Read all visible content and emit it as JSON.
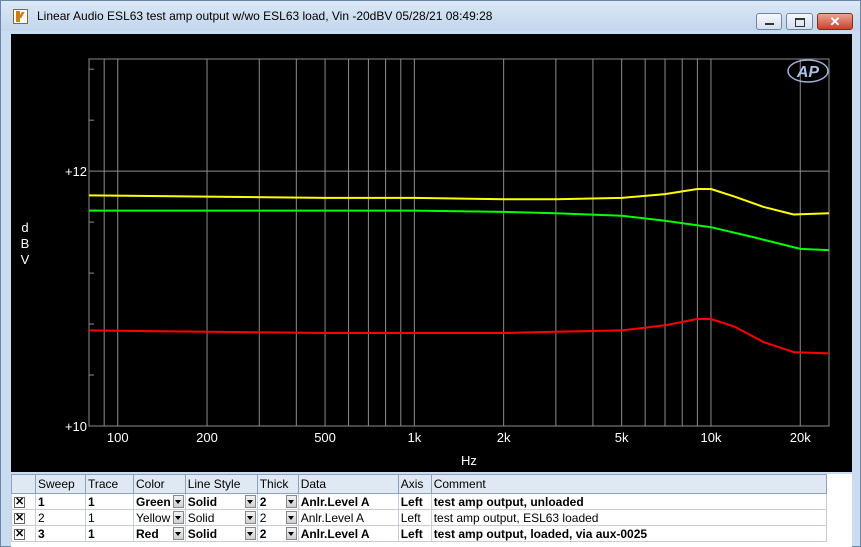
{
  "window": {
    "title": "Linear Audio  ESL63 test amp output w/wo ESL63 load, Vin -20dBV  05/28/21 08:49:28"
  },
  "logo": "AP",
  "chart_data": {
    "type": "line",
    "ylabel": [
      "d",
      "B",
      "V"
    ],
    "xlabel": "Hz",
    "xscale": "log",
    "xlim": [
      80,
      25000
    ],
    "ylim": [
      10,
      12.88
    ],
    "x_ticks": [
      {
        "v": 100,
        "label": "100"
      },
      {
        "v": 200,
        "label": "200"
      },
      {
        "v": 500,
        "label": "500"
      },
      {
        "v": 1000,
        "label": "1k"
      },
      {
        "v": 2000,
        "label": "2k"
      },
      {
        "v": 5000,
        "label": "5k"
      },
      {
        "v": 10000,
        "label": "10k"
      },
      {
        "v": 20000,
        "label": "20k"
      }
    ],
    "y_ticks": [
      {
        "v": 10,
        "label": "+10"
      },
      {
        "v": 12,
        "label": "+12"
      }
    ],
    "series": [
      {
        "name": "test amp output, unloaded",
        "color": "#00ff00",
        "x": [
          80,
          200,
          500,
          1000,
          2000,
          3000,
          5000,
          7000,
          10000,
          14000,
          20000,
          25000
        ],
        "y": [
          11.69,
          11.69,
          11.69,
          11.69,
          11.68,
          11.67,
          11.65,
          11.61,
          11.56,
          11.48,
          11.39,
          11.38
        ]
      },
      {
        "name": "test amp output, ESL63 loaded",
        "color": "#ffff00",
        "x": [
          80,
          200,
          500,
          1000,
          2000,
          3000,
          5000,
          7000,
          9000,
          10000,
          12000,
          15000,
          19000,
          25000
        ],
        "y": [
          11.81,
          11.8,
          11.79,
          11.79,
          11.78,
          11.78,
          11.79,
          11.82,
          11.86,
          11.86,
          11.8,
          11.72,
          11.66,
          11.67
        ]
      },
      {
        "name": "test amp output, loaded, via aux-0025",
        "color": "#ff0000",
        "x": [
          80,
          200,
          500,
          1000,
          2000,
          3000,
          5000,
          7000,
          9000,
          10000,
          12000,
          15000,
          19000,
          25000
        ],
        "y": [
          10.75,
          10.74,
          10.73,
          10.73,
          10.73,
          10.74,
          10.75,
          10.79,
          10.84,
          10.84,
          10.78,
          10.66,
          10.58,
          10.57
        ]
      }
    ]
  },
  "table": {
    "headers": [
      "Sweep",
      "Trace",
      "Color",
      "Line Style",
      "Thick",
      "Data",
      "Axis",
      "Comment"
    ],
    "rows": [
      {
        "sweep": "1",
        "trace": "1",
        "color": "Green",
        "style": "Solid",
        "thick": "2",
        "data": "Anlr.Level A",
        "axis": "Left",
        "comment": "test amp output, unloaded"
      },
      {
        "sweep": "2",
        "trace": "1",
        "color": "Yellow",
        "style": "Solid",
        "thick": "2",
        "data": "Anlr.Level A",
        "axis": "Left",
        "comment": "test amp output, ESL63 loaded"
      },
      {
        "sweep": "3",
        "trace": "1",
        "color": "Red",
        "style": "Solid",
        "thick": "2",
        "data": "Anlr.Level A",
        "axis": "Left",
        "comment": "test amp output, loaded, via aux-0025"
      }
    ]
  }
}
